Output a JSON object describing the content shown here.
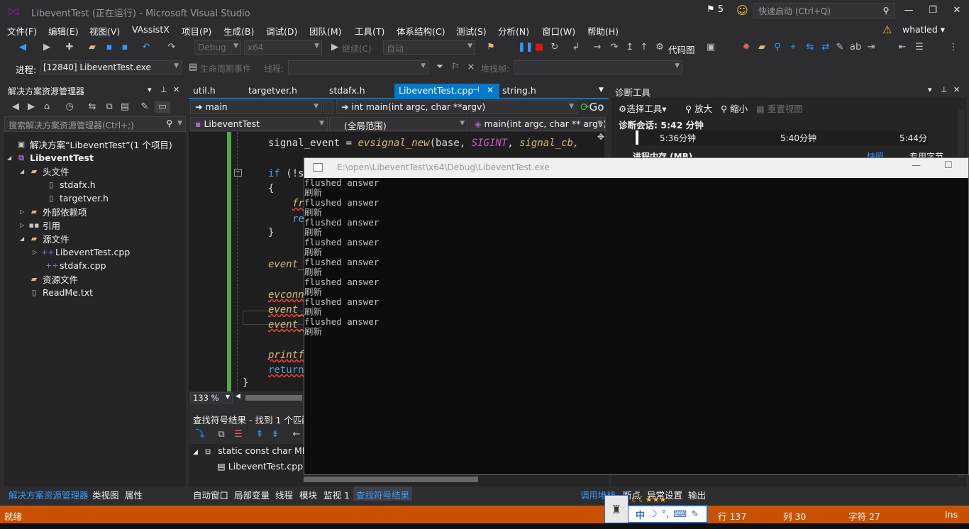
{
  "window": {
    "title": "LibeventTest (正在运行) - Microsoft Visual Studio",
    "notifications": "5",
    "quick_launch_placeholder": "快速启动 (Ctrl+Q)",
    "user": "whatled"
  },
  "menu": [
    "文件(F)",
    "编辑(E)",
    "视图(V)",
    "VAssistX",
    "项目(P)",
    "生成(B)",
    "调试(D)",
    "团队(M)",
    "工具(T)",
    "体系结构(C)",
    "测试(S)",
    "分析(N)",
    "窗口(W)",
    "帮助(H)"
  ],
  "toolbar": {
    "config": "Debug",
    "platform": "x64",
    "continue_label": "继续(C)",
    "auto_combo": "自动",
    "code_map": "代码图"
  },
  "debug_bar": {
    "process_label": "进程:",
    "process_value": "[12840] LibeventTest.exe",
    "lifecycle": "生命周期事件",
    "thread_label": "线程:",
    "stackframe_label": "堆栈帧:"
  },
  "solution_explorer": {
    "title": "解决方案资源管理器",
    "search_placeholder": "搜索解决方案资源管理器(Ctrl+;)",
    "items": [
      {
        "label": "解决方案“LibeventTest”(1 个项目)",
        "icon": "solution-icon"
      },
      {
        "label": "LibeventTest",
        "icon": "project-icon"
      },
      {
        "label": "头文件",
        "icon": "folder-icon"
      },
      {
        "label": "stdafx.h",
        "icon": "header-file-icon"
      },
      {
        "label": "targetver.h",
        "icon": "header-file-icon"
      },
      {
        "label": "外部依赖项",
        "icon": "folder-icon"
      },
      {
        "label": "引用",
        "icon": "references-icon"
      },
      {
        "label": "源文件",
        "icon": "folder-icon"
      },
      {
        "label": "LibeventTest.cpp",
        "icon": "cpp-file-icon"
      },
      {
        "label": "stdafx.cpp",
        "icon": "cpp-file-icon"
      },
      {
        "label": "资源文件",
        "icon": "folder-icon"
      },
      {
        "label": "ReadMe.txt",
        "icon": "text-file-icon"
      }
    ]
  },
  "editor": {
    "tabs": [
      "util.h",
      "targetver.h",
      "stdafx.h",
      "LibeventTest.cpp",
      "string.h"
    ],
    "active_tab": "LibeventTest.cpp",
    "nav_function": "main",
    "nav_signature": "int main(int argc, char **argv)",
    "go_label": "Go",
    "nav_project": "LibeventTest",
    "nav_scope": "(全局范围)",
    "nav_member": "main(int argc, char ** argv)",
    "zoom": "133 %",
    "lines": {
      "l1_var": "signal_event",
      "l1_eq": " = ",
      "l1_fn": "evsignal_new",
      "l1_args_a": "(base, ",
      "l1_mac": "SIGINT",
      "l1_args_b": ", ",
      "l1_arg3": "signal_cb,",
      "l2_kw": "if",
      "l2_rest": " (!s",
      "l3": "{",
      "l4": "fr",
      "l5": "re",
      "l6": "}",
      "l7": "event_",
      "l8": "evconn",
      "l9": "event_",
      "l10": "event_",
      "l11": "printf",
      "l12": "return",
      "l13": "}"
    }
  },
  "find_results": {
    "title": "查找符号结果 - 找到 1 个匹配",
    "row1": "static const char MES",
    "row2": "LibeventTest.cpp("
  },
  "diagnostics": {
    "title": "诊断工具",
    "select_tool": "选择工具",
    "zoom_in": "放大",
    "zoom_out": "缩小",
    "reset_view": "重置视图",
    "session": "诊断会话: 5:42 分钟",
    "ticks": [
      "5:36分钟",
      "5:40分钟",
      "5:44分"
    ],
    "memory_label": "进程内存 (MB)",
    "snapshot": "快照",
    "private_bytes": "专用字节"
  },
  "console": {
    "title": "E:\\open\\LibeventTest\\x64\\Debug\\LibeventTest.exe",
    "lines": [
      "flushed answer",
      "刷新",
      "flushed answer",
      "刷新",
      "flushed answer",
      "刷新",
      "flushed answer",
      "刷新",
      "flushed answer",
      "刷新",
      "flushed answer",
      "刷新",
      "flushed answer",
      "刷新",
      "flushed answer",
      "刷新"
    ]
  },
  "bottom_tabs_left": [
    "解决方案资源管理器",
    "类视图",
    "属性"
  ],
  "bottom_tabs_mid": [
    "自动窗口",
    "局部变量",
    "线程",
    "模块",
    "监视 1",
    "查找符号结果"
  ],
  "bottom_tabs_right": [
    "调用堆栈",
    "断点",
    "异常设置",
    "输出"
  ],
  "status": {
    "ready": "就绪",
    "line": "行 137",
    "col": "列 30",
    "char": "字符 27",
    "mode": "Ins"
  },
  "ime": {
    "lang": "中",
    "symbols": "°,"
  },
  "colors": {
    "accent": "#007acc",
    "status_bar": "#ca5100",
    "background": "#2d2d30"
  }
}
